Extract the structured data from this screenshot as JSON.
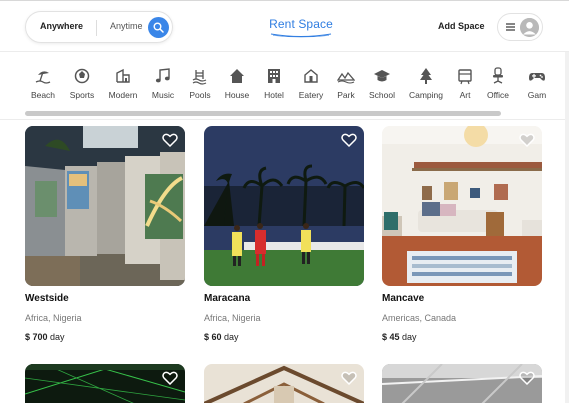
{
  "header": {
    "search": {
      "where_label": "Anywhere",
      "when_label": "Anytime",
      "button_icon": "search-icon"
    },
    "logo_text": "Rent Space",
    "add_space_label": "Add Space",
    "menu_icon": "hamburger-icon",
    "avatar_icon": "user-avatar-icon"
  },
  "colors": {
    "accent": "#3a86e8",
    "logo": "#2f7de1"
  },
  "categories": [
    {
      "label": "Beach",
      "icon": "beach-icon"
    },
    {
      "label": "Sports",
      "icon": "sports-ball-icon"
    },
    {
      "label": "Modern",
      "icon": "modern-building-icon"
    },
    {
      "label": "Music",
      "icon": "music-note-icon"
    },
    {
      "label": "Pools",
      "icon": "pool-icon"
    },
    {
      "label": "House",
      "icon": "house-icon"
    },
    {
      "label": "Hotel",
      "icon": "hotel-icon"
    },
    {
      "label": "Eatery",
      "icon": "eatery-icon"
    },
    {
      "label": "Park",
      "icon": "park-icon"
    },
    {
      "label": "School",
      "icon": "school-cap-icon"
    },
    {
      "label": "Camping",
      "icon": "camping-tree-icon"
    },
    {
      "label": "Art",
      "icon": "art-icon"
    },
    {
      "label": "Office",
      "icon": "office-chair-icon"
    },
    {
      "label": "Gam",
      "icon": "gamepad-icon"
    }
  ],
  "listings": [
    {
      "name": "Westside",
      "location": "Africa, Nigeria",
      "price": "$ 700",
      "unit": "day"
    },
    {
      "name": "Maracana",
      "location": "Africa, Nigeria",
      "price": "$ 60",
      "unit": "day"
    },
    {
      "name": "Mancave",
      "location": "Americas, Canada",
      "price": "$ 45",
      "unit": "day"
    }
  ]
}
